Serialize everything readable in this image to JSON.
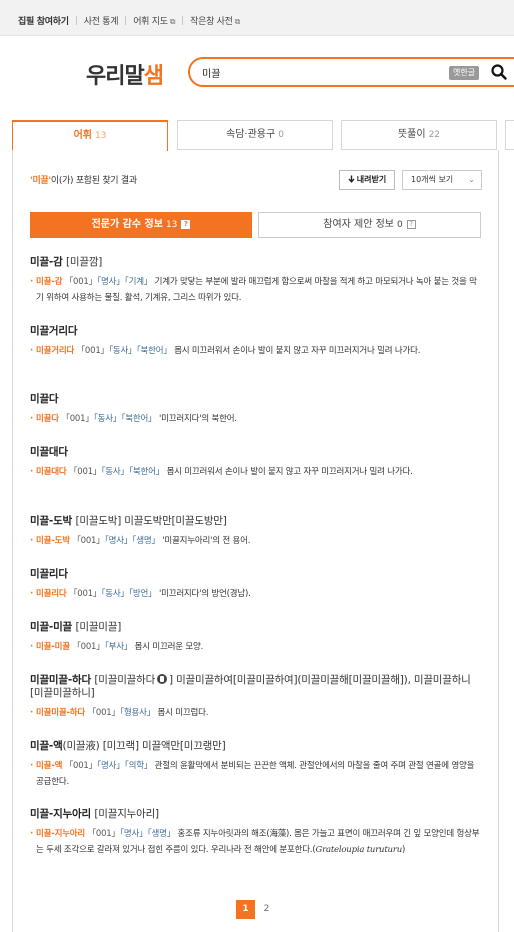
{
  "topbar": {
    "links": [
      {
        "label": "집필 참여하기",
        "external": false
      },
      {
        "label": "사전 통계",
        "external": false
      },
      {
        "label": "어휘 지도",
        "external": true
      },
      {
        "label": "작은창 사전",
        "external": true
      }
    ],
    "external_glyph": "⧉"
  },
  "logo": {
    "text_main": "우리말",
    "text_accent": "샘",
    "accent_color": "#f47321"
  },
  "search": {
    "query": "미끌",
    "placeholder": "",
    "old_hangul_label": "옛한글",
    "icon": "search-icon"
  },
  "tabs": [
    {
      "label": "어휘",
      "count": "13",
      "active": true
    },
    {
      "label": "속담·관용구",
      "count": "0",
      "active": false
    },
    {
      "label": "뜻풀이",
      "count": "22",
      "active": false
    }
  ],
  "result": {
    "keyword": "'미끌'",
    "suffix": "이(가) 포함된 찾기 결과"
  },
  "download_label": "내려받기",
  "download_icon": "download-icon",
  "view_select": {
    "value": "10개씩 보기",
    "icon": "chevron-down-icon"
  },
  "subtabs": [
    {
      "label": "전문가 감수 정보",
      "count": "13",
      "q": "?"
    },
    {
      "label": "참여자 제안 정보",
      "count": "0",
      "q": "?"
    }
  ],
  "entries": [
    {
      "head": "미끌-감",
      "pron": "[미끌깜]",
      "word": "미끌-감",
      "code": "「001」",
      "pos": "「명사」",
      "cat": "「기계」",
      "text": "기계가 맞닿는 부분에 발라 매끄럽게 함으로써 마찰을 적게 하고 마모되거나 녹아 붙는 것을 막기 위하여 사용하는 물질. 활석, 기계유, 그리스 따위가 있다."
    },
    {
      "head": "미끌거리다",
      "pron": "",
      "word": "미끌거리다",
      "code": "「001」",
      "pos": "「동사」",
      "cat": "「북한어」",
      "text": "몹시 미끄러워서 손이나 발이 붙지 않고 자꾸 미끄러지거나 밀려 나가다."
    },
    {
      "head": "미끌다",
      "pron": "",
      "word": "미끌다",
      "code": "「001」",
      "pos": "「동사」",
      "cat": "「북한어」",
      "text": "'미끄러지다'의 북한어."
    },
    {
      "head": "미끌대다",
      "pron": "",
      "word": "미끌대다",
      "code": "「001」",
      "pos": "「동사」",
      "cat": "「북한어」",
      "text": "몹시 미끄러워서 손이나 발이 붙지 않고 자꾸 미끄러지거나 밀려 나가다."
    },
    {
      "head": "미끌-도박",
      "pron": "[미끌도박] 미끌도박만[미끌도방만]",
      "word": "미끌-도박",
      "code": "「001」",
      "pos": "「명사」",
      "cat": "「생명」",
      "text": "'미끌지누아리'의 전 용어."
    },
    {
      "head": "미끌리다",
      "pron": "",
      "word": "미끌리다",
      "code": "「001」",
      "pos": "「동사」",
      "cat": "「방언」",
      "text": "'미끄러지다'의 방언(경남)."
    },
    {
      "head": "미끌-미끌",
      "pron": "[미끌미끌]",
      "word": "미끌-미끌",
      "code": "「001」",
      "pos": "「부사」",
      "cat": "",
      "text": "몹시 미끄러운 모양."
    },
    {
      "head": "미끌미끌-하다",
      "pron_a": "[미끌미끌하다",
      "pron_b": "] 미끌미끌하여[미끌미끌하여](미끌미끌해[미끌미끌해]), 미끌미끌하니[미끌미끌하니]",
      "word": "미끌미끌-하다",
      "code": "「001」",
      "pos": "「형용사」",
      "cat": "",
      "text": "몹시 미끄럽다."
    },
    {
      "head": "미끌-액",
      "pron": "(미끌液) [미끄랙] 미끌액만[미끄랭만]",
      "word": "미끌-액",
      "code": "「001」",
      "pos": "「명사」",
      "cat": "「의학」",
      "text": "관절의 윤활막에서 분비되는 끈끈한 액체. 관절안에서의 마찰을 줄여 주며 관절 연골에 영양을 공급한다."
    },
    {
      "head": "미끌-지누아리",
      "pron": "[미끌지누아리]",
      "word": "미끌-지누아리",
      "code": "「001」",
      "pos": "「명사」",
      "cat": "「생명」",
      "text": "홍조류 지누아릿과의 해조(海藻). 몸은 가늘고 표면이 매끄러우며 긴 잎 모양인데 헝상부는 두세 조각으로 갈라져 있거나 접힌 주름이 있다. 우리나라 전 해안에 분포한다.",
      "sci_open": "(",
      "sci": "Grateloupia turuturu",
      "sci_close": ")"
    }
  ],
  "pagination": {
    "current": "1",
    "other": "2"
  }
}
